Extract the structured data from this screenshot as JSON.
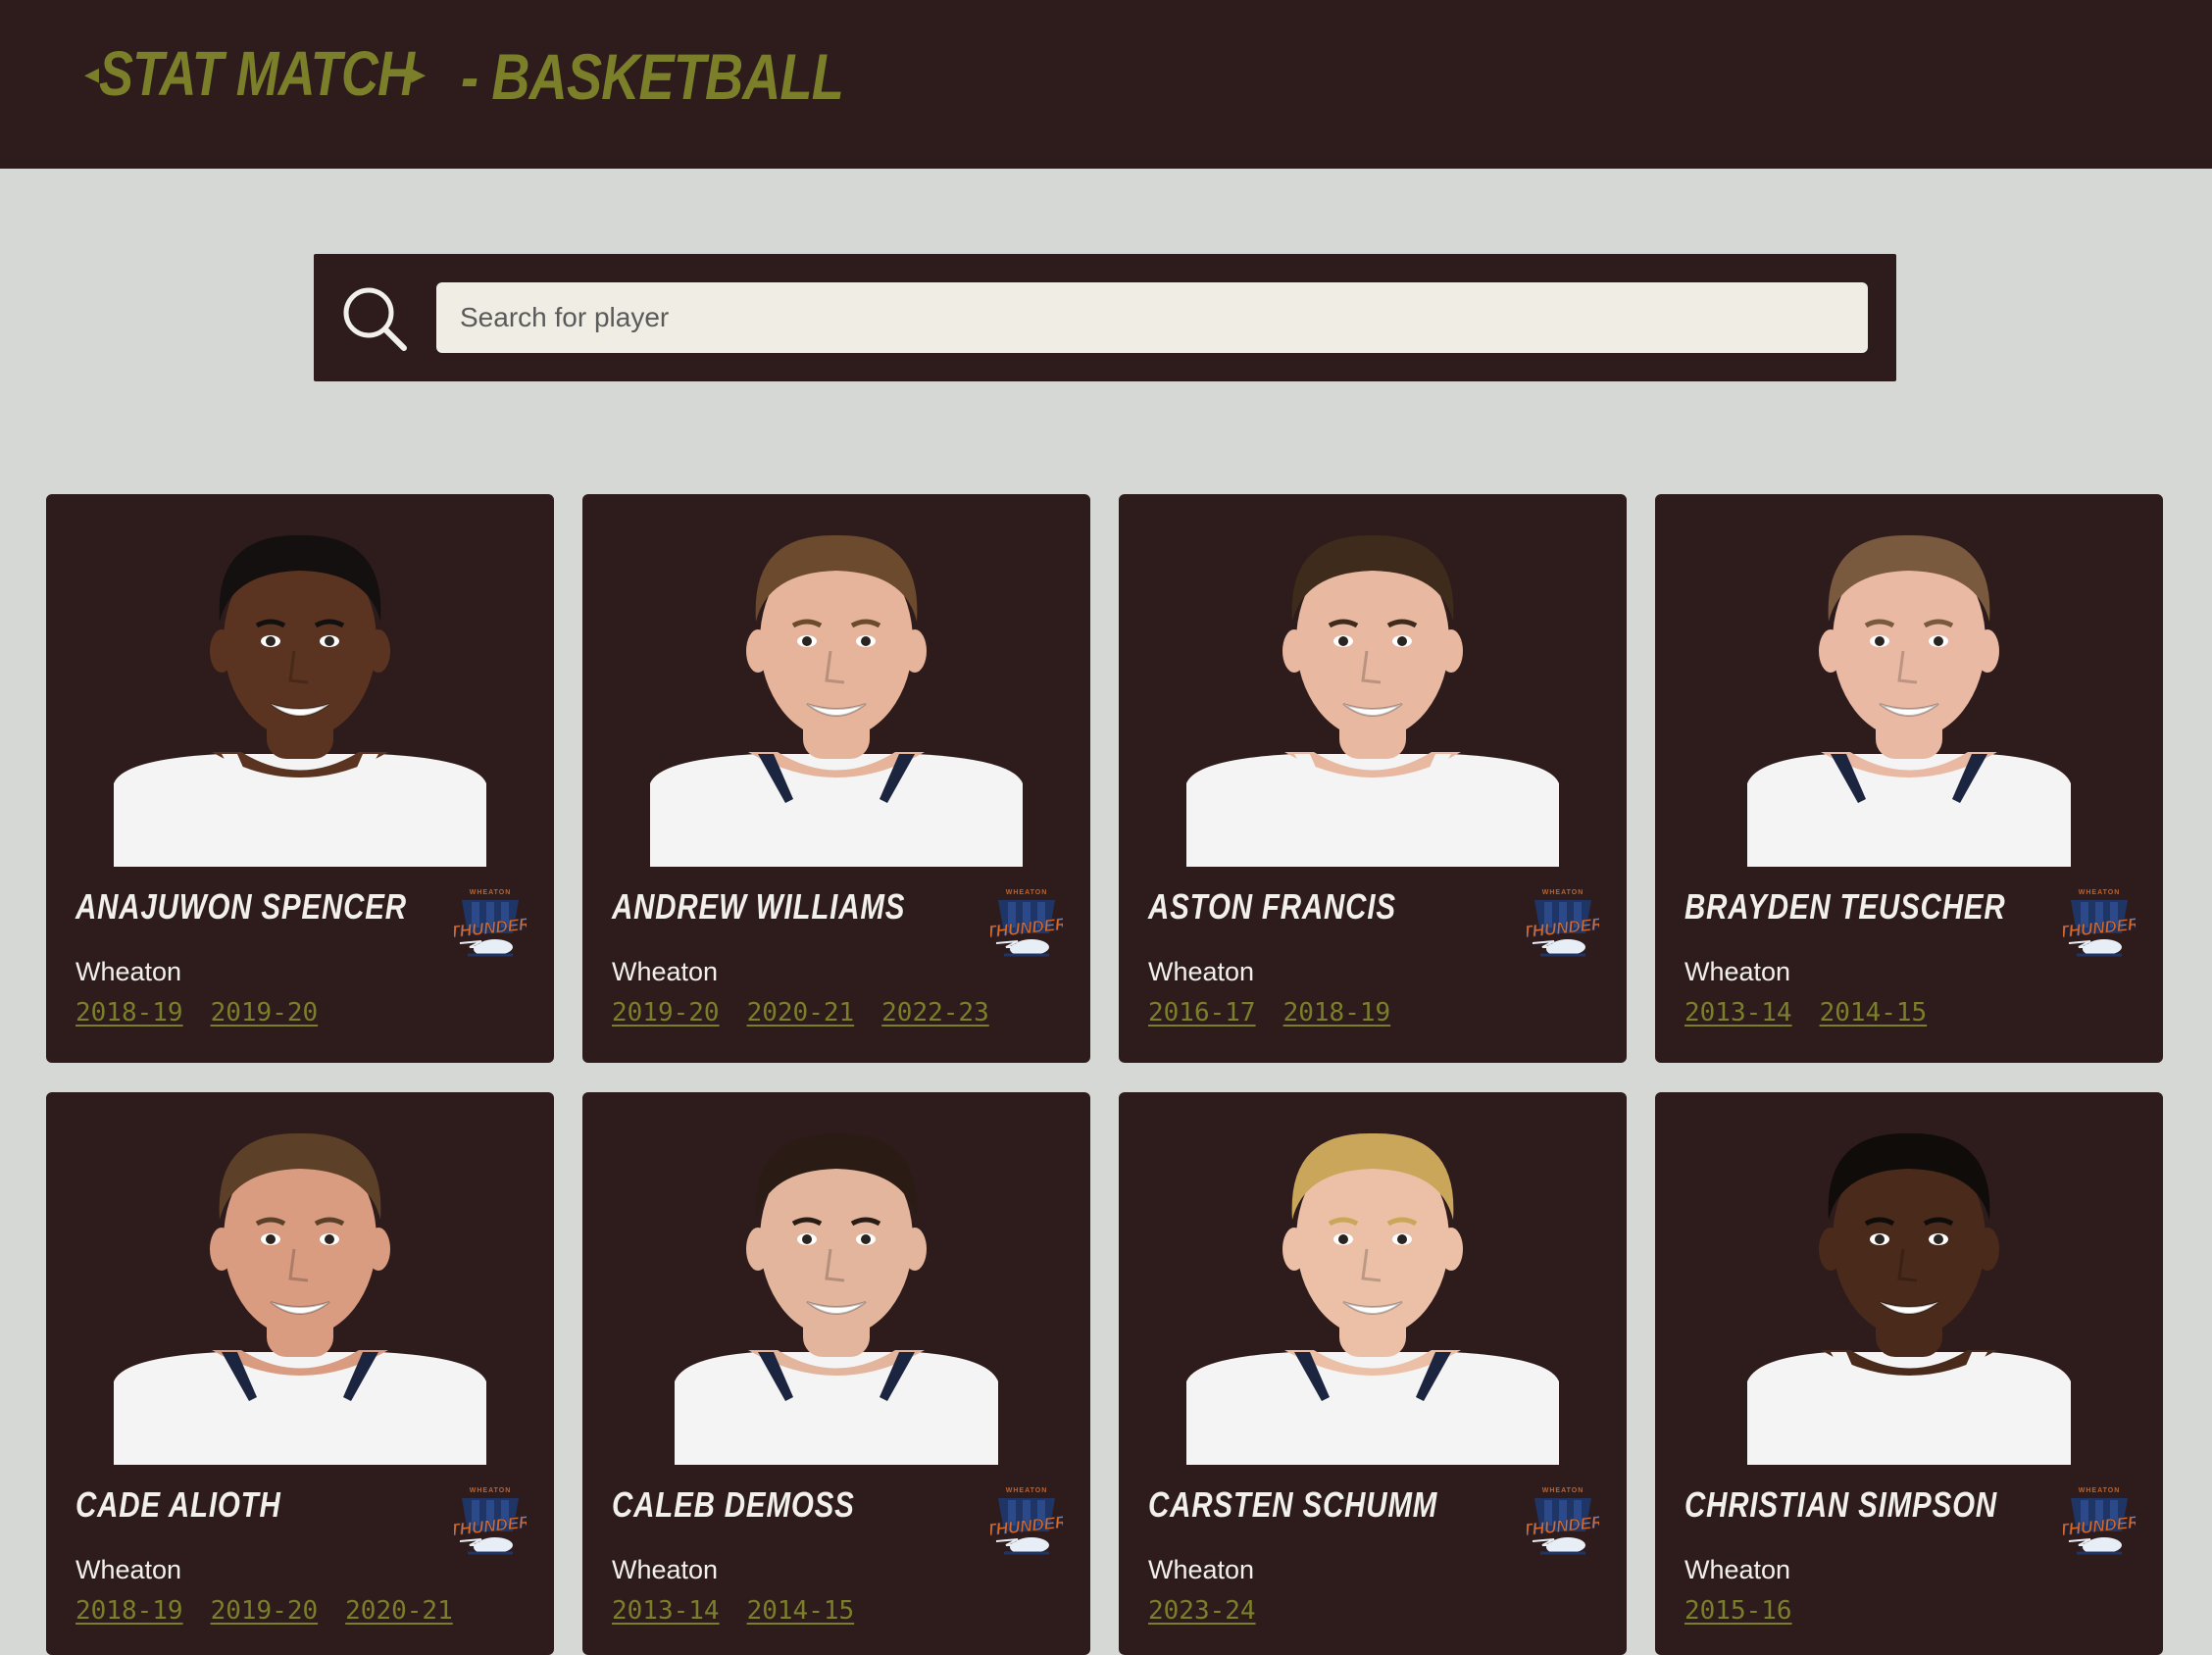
{
  "header": {
    "logo_text": "STAT MATCH",
    "logo_suffix": "- BASKETBALL"
  },
  "search": {
    "placeholder": "Search for player"
  },
  "colors": {
    "background": "#d5d8d5",
    "panel": "#2e1c1d",
    "accent": "#7b7f2a",
    "text": "#f2f0ea",
    "input_bg": "#efede4"
  },
  "players": [
    {
      "name": "Anajuwon Spencer",
      "team": "Wheaton",
      "seasons": [
        "2018-19",
        "2019-20"
      ],
      "skin": "#5a3420",
      "hair": "#141010",
      "jersey": "#f4f4f4",
      "trim": "#f4f4f4"
    },
    {
      "name": "Andrew Williams",
      "team": "Wheaton",
      "seasons": [
        "2019-20",
        "2020-21",
        "2022-23"
      ],
      "skin": "#e6b49a",
      "hair": "#6b4a2e",
      "jersey": "#f4f4f4",
      "trim": "#1b2540"
    },
    {
      "name": "Aston Francis",
      "team": "Wheaton",
      "seasons": [
        "2016-17",
        "2018-19"
      ],
      "skin": "#e8b8a0",
      "hair": "#3e2b1c",
      "jersey": "#f4f4f4",
      "trim": "#f4f4f4"
    },
    {
      "name": "Brayden Teuscher",
      "team": "Wheaton",
      "seasons": [
        "2013-14",
        "2014-15"
      ],
      "skin": "#eab9a4",
      "hair": "#7a5a3e",
      "jersey": "#f4f4f4",
      "trim": "#1b2540"
    },
    {
      "name": "Cade Alioth",
      "team": "Wheaton",
      "seasons": [
        "2018-19",
        "2019-20",
        "2020-21"
      ],
      "skin": "#d99c80",
      "hair": "#5c4028",
      "jersey": "#f4f4f4",
      "trim": "#1b2540"
    },
    {
      "name": "Caleb Demoss",
      "team": "Wheaton",
      "seasons": [
        "2013-14",
        "2014-15"
      ],
      "skin": "#e2b59c",
      "hair": "#2a1c14",
      "jersey": "#f4f4f4",
      "trim": "#1b2540"
    },
    {
      "name": "Carsten Schumm",
      "team": "Wheaton",
      "seasons": [
        "2023-24"
      ],
      "skin": "#ecc0a6",
      "hair": "#c9a65a",
      "jersey": "#f4f4f4",
      "trim": "#1b2540"
    },
    {
      "name": "Christian Simpson",
      "team": "Wheaton",
      "seasons": [
        "2015-16"
      ],
      "skin": "#4a2a1a",
      "hair": "#100c0a",
      "jersey": "#f4f4f4",
      "trim": "#f4f4f4"
    }
  ]
}
